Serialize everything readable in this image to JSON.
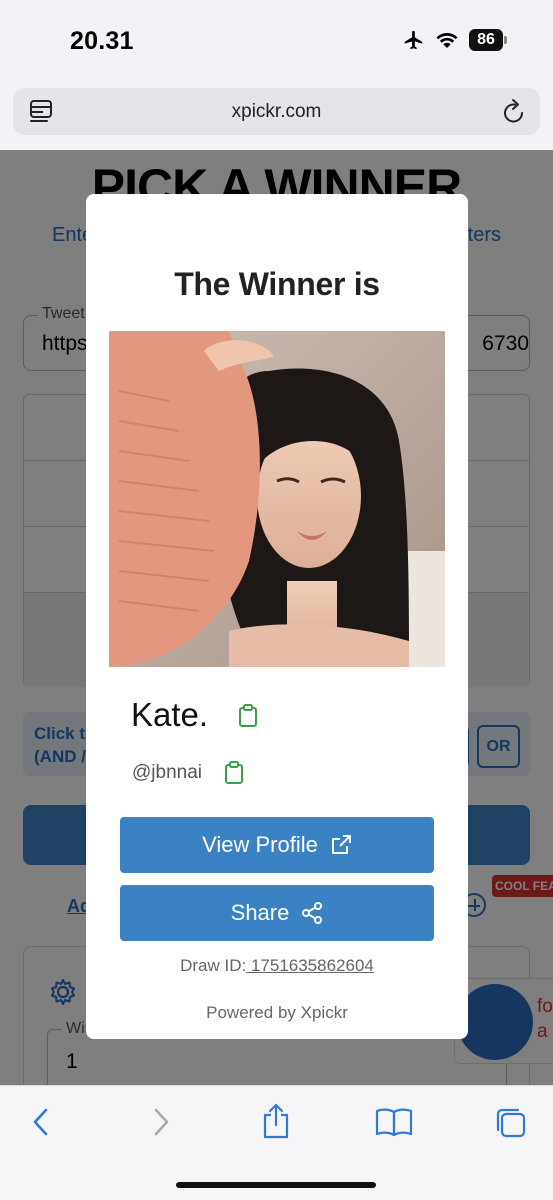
{
  "status_bar": {
    "time": "20.31",
    "battery": "86",
    "icons": [
      "airplane-icon",
      "wifi-icon",
      "battery-icon"
    ]
  },
  "browser": {
    "url": "xpickr.com",
    "icons": [
      "tabs-icon",
      "reload-icon"
    ]
  },
  "background_page": {
    "title": "PICK A WINNER",
    "link_left": "Ente",
    "link_right": "ters",
    "tweet_field": {
      "label": "Tweet",
      "value_left": "https",
      "value_right": "6730"
    },
    "filter_text_line1": "Click t",
    "filter_text_line2": "(AND /",
    "or_label": "OR",
    "ad_link": "Ad",
    "cool_badge": "COOL FEAT",
    "winner_count": {
      "label": "Winner Count",
      "value": "1"
    },
    "promo_line1": "fo",
    "promo_line2": "a do"
  },
  "modal": {
    "title": "The Winner is",
    "winner_name": "Kate.",
    "winner_handle": "@jbnnai",
    "view_profile_label": "View Profile",
    "share_label": "Share",
    "draw_id_label": "Draw ID:",
    "draw_id_value": " 1751635862604",
    "powered_by": "Powered by Xpickr"
  },
  "toolbar": {
    "icons": [
      "back-icon",
      "forward-icon",
      "share-icon",
      "bookmarks-icon",
      "tabs-overview-icon"
    ]
  },
  "colors": {
    "primary_button": "#3a82c4",
    "link_blue": "#2a6ebf",
    "clipboard_green": "#3aa14a",
    "ios_blue": "#2f7ad9"
  }
}
